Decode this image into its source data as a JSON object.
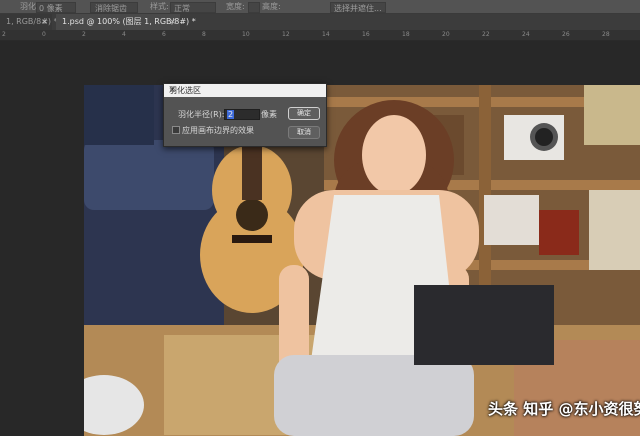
{
  "options_bar": {
    "feather_label": "羽化:",
    "feather_value": "0 像素",
    "antialias_label": "消除锯齿",
    "style_label": "样式:",
    "style_value": "正常",
    "width_label": "宽度:",
    "height_label": "高度:",
    "select_mask_label": "选择并遮住..."
  },
  "tabs": [
    {
      "label": "1, RGB/8#) *",
      "active": false
    },
    {
      "label": "1.psd @ 100% (图层 1, RGB/8#) *",
      "active": true
    }
  ],
  "ruler_ticks": [
    "2",
    "0",
    "2",
    "4",
    "6",
    "8",
    "10",
    "12",
    "14",
    "16",
    "18",
    "20",
    "22",
    "24",
    "26",
    "28"
  ],
  "feather_dialog": {
    "title": "羽化选区",
    "close_icon": "close-icon",
    "radius_label": "羽化半径(R):",
    "radius_value": "2",
    "unit": "像素",
    "apply_canvas_label": "应用画布边界的效果",
    "apply_canvas_checked": false,
    "ok_label": "确定",
    "cancel_label": "取消"
  },
  "watermark": "头条 知乎 @东小资很努力",
  "colors": {
    "panel": "#535353",
    "canvas_bg": "#282828",
    "selection_highlight": "#3d6ad8"
  }
}
